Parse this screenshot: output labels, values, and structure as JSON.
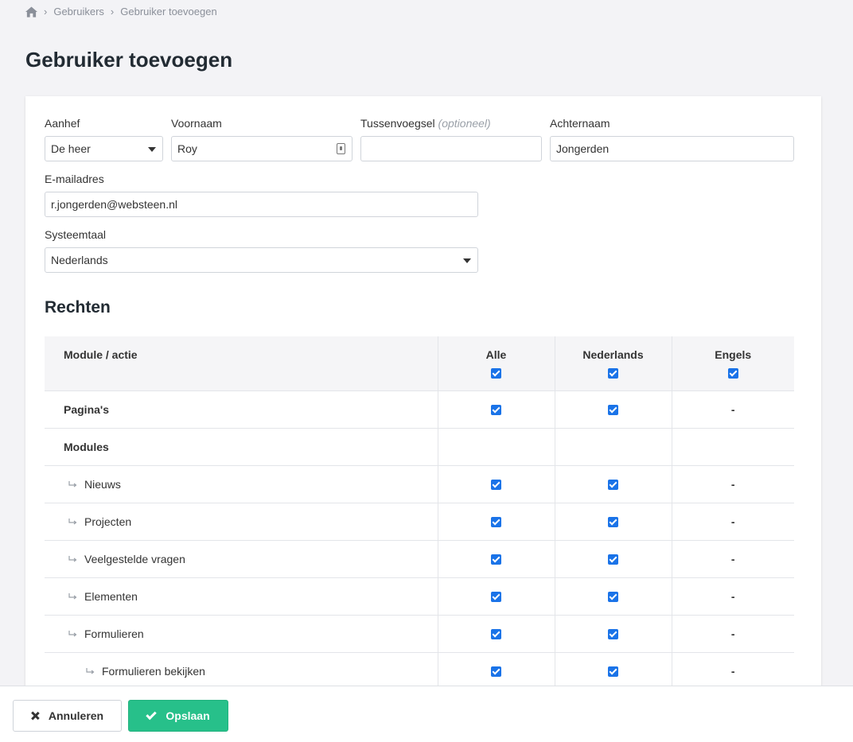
{
  "breadcrumb": {
    "items": [
      "Gebruikers",
      "Gebruiker toevoegen"
    ]
  },
  "page_title": "Gebruiker toevoegen",
  "form": {
    "aanhef": {
      "label": "Aanhef",
      "value": "De heer"
    },
    "voornaam": {
      "label": "Voornaam",
      "value": "Roy"
    },
    "tussenvoegsel": {
      "label": "Tussenvoegsel",
      "hint": "(optioneel)",
      "value": ""
    },
    "achternaam": {
      "label": "Achternaam",
      "value": "Jongerden"
    },
    "email": {
      "label": "E-mailadres",
      "value": "r.jongerden@websteen.nl"
    },
    "systeemtaal": {
      "label": "Systeemtaal",
      "value": "Nederlands"
    }
  },
  "rights": {
    "title": "Rechten",
    "columns": [
      "Module / actie",
      "Alle",
      "Nederlands",
      "Engels"
    ],
    "header_checked": [
      true,
      true,
      true
    ],
    "rows": [
      {
        "name": "Pagina's",
        "level": 0,
        "bold": true,
        "alle": "check",
        "nl": "check",
        "en": "-"
      },
      {
        "name": "Modules",
        "level": 0,
        "bold": true,
        "alle": "",
        "nl": "",
        "en": ""
      },
      {
        "name": "Nieuws",
        "level": 1,
        "bold": false,
        "alle": "check",
        "nl": "check",
        "en": "-"
      },
      {
        "name": "Projecten",
        "level": 1,
        "bold": false,
        "alle": "check",
        "nl": "check",
        "en": "-"
      },
      {
        "name": "Veelgestelde vragen",
        "level": 1,
        "bold": false,
        "alle": "check",
        "nl": "check",
        "en": "-"
      },
      {
        "name": "Elementen",
        "level": 1,
        "bold": false,
        "alle": "check",
        "nl": "check",
        "en": "-"
      },
      {
        "name": "Formulieren",
        "level": 1,
        "bold": false,
        "alle": "check",
        "nl": "check",
        "en": "-"
      },
      {
        "name": "Formulieren bekijken",
        "level": 2,
        "bold": false,
        "alle": "check",
        "nl": "check",
        "en": "-"
      }
    ]
  },
  "footer": {
    "cancel_label": "Annuleren",
    "save_label": "Opslaan"
  },
  "colors": {
    "accent": "#1a73e8",
    "save": "#27c08a",
    "background": "#f3f3f6"
  }
}
